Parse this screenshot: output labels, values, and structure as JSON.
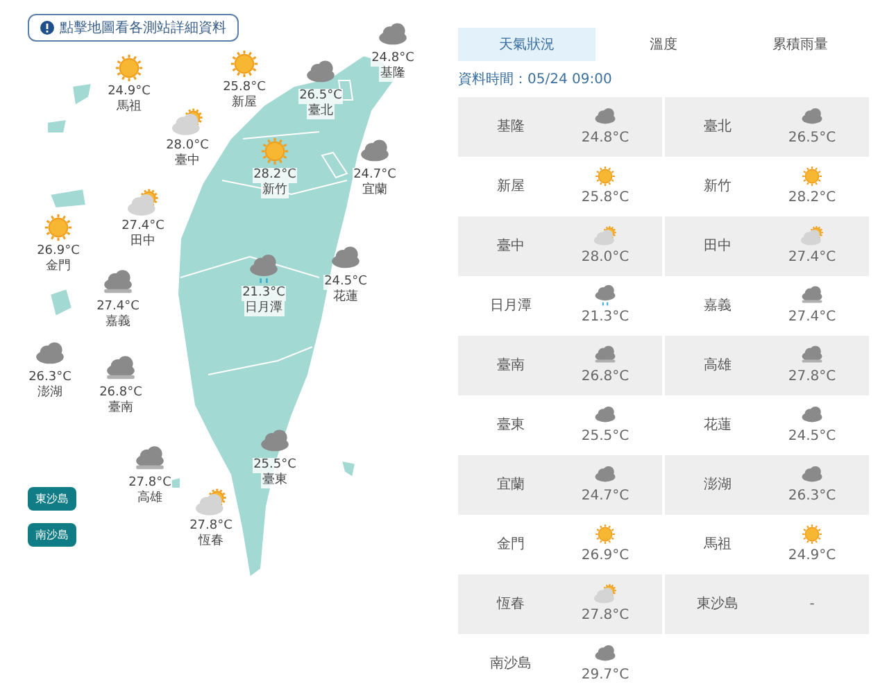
{
  "map": {
    "hint": "點擊地圖看各測站詳細資料",
    "stations": [
      {
        "name": "基隆",
        "temp": "24.8°C",
        "kind": "cloudy"
      },
      {
        "name": "馬祖",
        "temp": "24.9°C",
        "kind": "sunny"
      },
      {
        "name": "新屋",
        "temp": "25.8°C",
        "kind": "sunny"
      },
      {
        "name": "臺北",
        "temp": "26.5°C",
        "kind": "cloudy"
      },
      {
        "name": "臺中",
        "temp": "28.0°C",
        "kind": "partly"
      },
      {
        "name": "新竹",
        "temp": "28.2°C",
        "kind": "sunny"
      },
      {
        "name": "宜蘭",
        "temp": "24.7°C",
        "kind": "cloudy"
      },
      {
        "name": "田中",
        "temp": "27.4°C",
        "kind": "partly"
      },
      {
        "name": "金門",
        "temp": "26.9°C",
        "kind": "sunny"
      },
      {
        "name": "花蓮",
        "temp": "24.5°C",
        "kind": "cloudy"
      },
      {
        "name": "日月潭",
        "temp": "21.3°C",
        "kind": "rain"
      },
      {
        "name": "嘉義",
        "temp": "27.4°C",
        "kind": "overcast"
      },
      {
        "name": "澎湖",
        "temp": "26.3°C",
        "kind": "cloudy"
      },
      {
        "name": "臺南",
        "temp": "26.8°C",
        "kind": "overcast"
      },
      {
        "name": "臺東",
        "temp": "25.5°C",
        "kind": "cloudy"
      },
      {
        "name": "高雄",
        "temp": "27.8°C",
        "kind": "overcast"
      },
      {
        "name": "恆春",
        "temp": "27.8°C",
        "kind": "partly"
      }
    ],
    "island_buttons": [
      "東沙島",
      "南沙島"
    ]
  },
  "tabs": [
    {
      "label": "天氣狀況",
      "selected": true
    },
    {
      "label": "溫度",
      "selected": false
    },
    {
      "label": "累積雨量",
      "selected": false
    }
  ],
  "data_time": "資料時間：05/24 09:00",
  "table": [
    {
      "name": "基隆",
      "temp": "24.8°C",
      "kind": "cloudy"
    },
    {
      "name": "臺北",
      "temp": "26.5°C",
      "kind": "cloudy"
    },
    {
      "name": "新屋",
      "temp": "25.8°C",
      "kind": "sunny"
    },
    {
      "name": "新竹",
      "temp": "28.2°C",
      "kind": "sunny"
    },
    {
      "name": "臺中",
      "temp": "28.0°C",
      "kind": "partly"
    },
    {
      "name": "田中",
      "temp": "27.4°C",
      "kind": "partly"
    },
    {
      "name": "日月潭",
      "temp": "21.3°C",
      "kind": "rain"
    },
    {
      "name": "嘉義",
      "temp": "27.4°C",
      "kind": "overcast"
    },
    {
      "name": "臺南",
      "temp": "26.8°C",
      "kind": "overcast"
    },
    {
      "name": "高雄",
      "temp": "27.8°C",
      "kind": "overcast"
    },
    {
      "name": "臺東",
      "temp": "25.5°C",
      "kind": "cloudy"
    },
    {
      "name": "花蓮",
      "temp": "24.5°C",
      "kind": "cloudy"
    },
    {
      "name": "宜蘭",
      "temp": "24.7°C",
      "kind": "cloudy"
    },
    {
      "name": "澎湖",
      "temp": "26.3°C",
      "kind": "cloudy"
    },
    {
      "name": "金門",
      "temp": "26.9°C",
      "kind": "sunny"
    },
    {
      "name": "馬祖",
      "temp": "24.9°C",
      "kind": "sunny"
    },
    {
      "name": "恆春",
      "temp": "27.8°C",
      "kind": "partly"
    },
    {
      "name": "東沙島",
      "temp": "-",
      "kind": "none"
    },
    {
      "name": "南沙島",
      "temp": "29.7°C",
      "kind": "cloudy"
    }
  ]
}
